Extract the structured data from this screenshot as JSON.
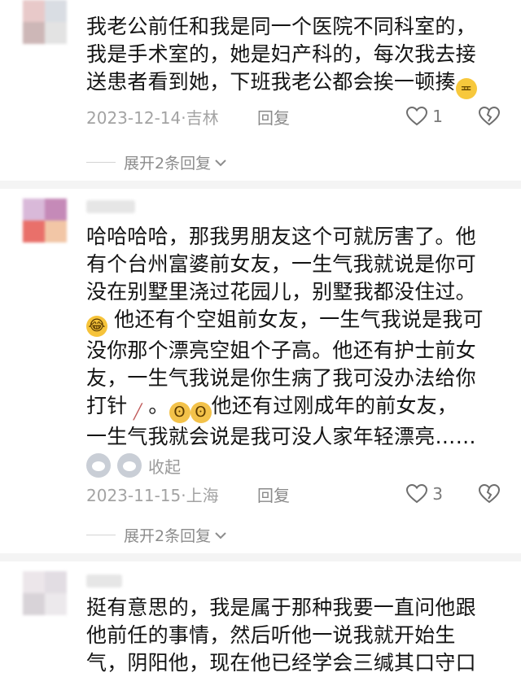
{
  "comments": [
    {
      "text_lines": [
        "我老公前任和我是同一个医院不同科室的，",
        "我是手术室的，她是妇产科的，每次我去接",
        "送患者看到她，下班我老公都会挨一顿揍"
      ],
      "date": "2023-12-14·吉林",
      "reply_label": "回复",
      "like_count": "1",
      "expand_label": "展开2条回复"
    },
    {
      "text_lines": [
        "哈哈哈哈，那我男朋友这个可就厉害了。他",
        "有个台州富婆前女友，一生气我就说是你可",
        "没在别墅里浇过花园儿，别墅我都没住过。",
        "他还有个空姐前女友，一生气我说是我可",
        "没你那个漂亮空姐个子高。他还有护士前女",
        "友，一生气我说是你生病了我可没办法给你",
        "打针",
        "他还有过刚成年的前女友，",
        "一生气我就会说是我可没人家年轻漂亮……"
      ],
      "collapse_label": "收起",
      "date": "2023-11-15·上海",
      "reply_label": "回复",
      "like_count": "3",
      "expand_label": "展开2条回复"
    },
    {
      "text_lines": [
        "挺有意思的，我是属于那种我要一直问他跟",
        "他前任的事情，然后听他一说我就开始生",
        "气，阴阳他，现在他已经学会三缄其口守口"
      ]
    }
  ],
  "icons": {
    "like": "heart-outline-icon",
    "dislike": "broken-heart-icon",
    "expand": "chevron-down-icon",
    "emoji_sweat": "smirk-emoji-icon",
    "emoji_laugh": "rofl-emoji-icon",
    "emoji_pray": "pleading-emoji-icon",
    "emoji_needle": "syringe-emoji-icon",
    "emoji_dog": "husky-emoji-icon"
  },
  "colors": {
    "text": "#141414",
    "meta": "#a3a3a3",
    "divider": "#f4f4f4"
  }
}
